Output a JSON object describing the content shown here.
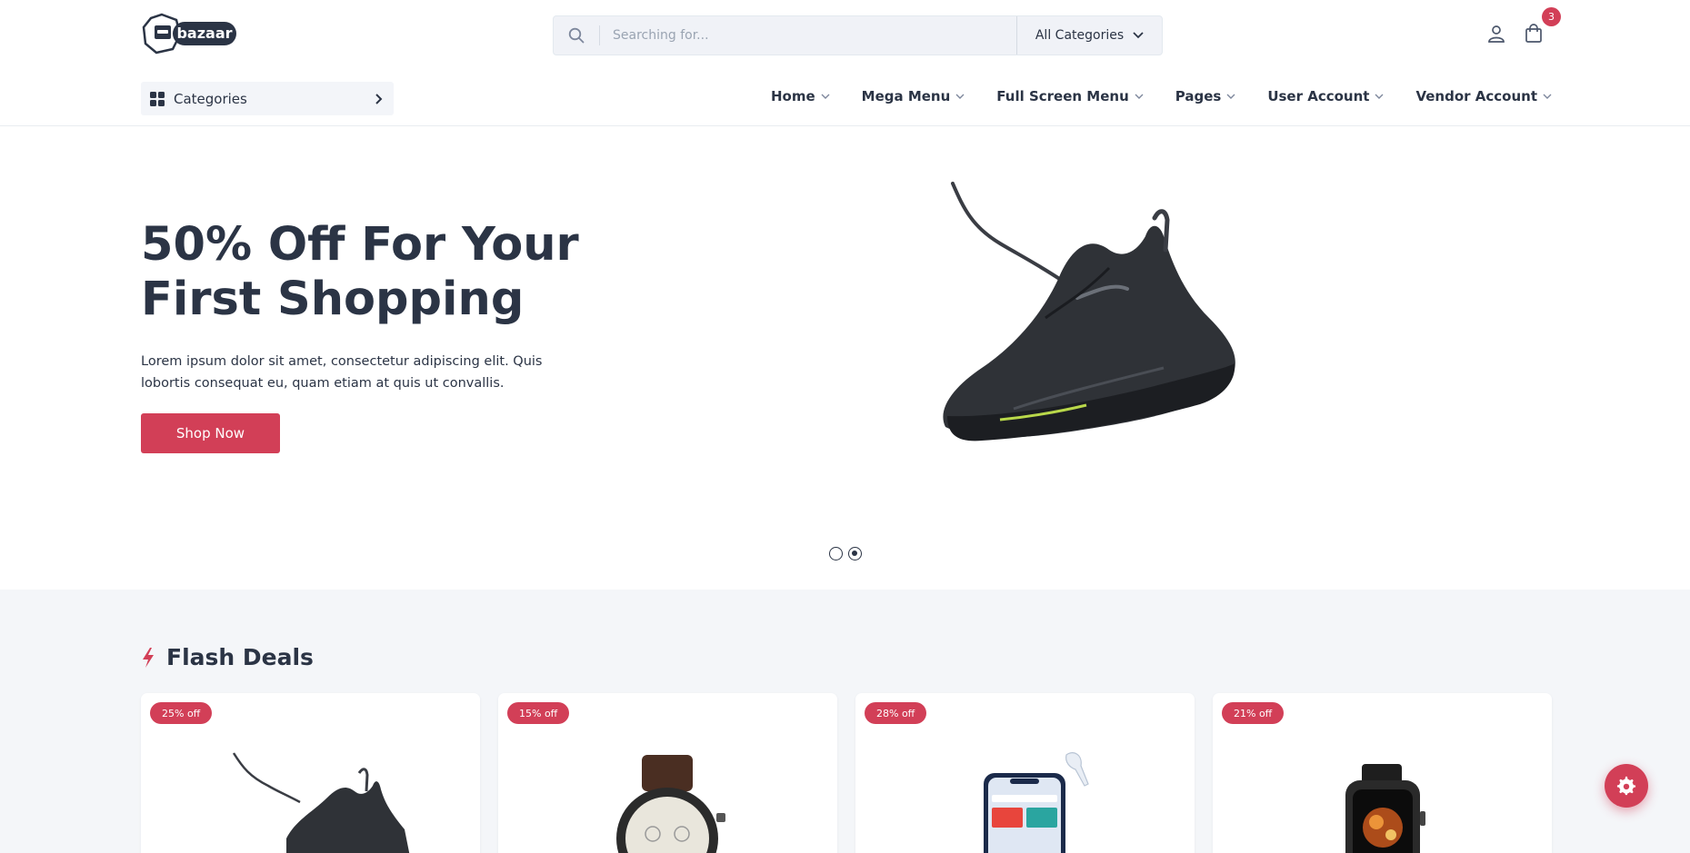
{
  "brand": {
    "logo_text": "bazaar"
  },
  "search": {
    "placeholder": "Searching for...",
    "category_label": "All Categories"
  },
  "header": {
    "cart_count": "3"
  },
  "nav": {
    "categories_label": "Categories",
    "items": [
      {
        "label": "Home"
      },
      {
        "label": "Mega Menu"
      },
      {
        "label": "Full Screen Menu"
      },
      {
        "label": "Pages"
      },
      {
        "label": "User Account"
      },
      {
        "label": "Vendor Account"
      }
    ]
  },
  "hero": {
    "title_line1": "50% Off For Your",
    "title_line2": "First Shopping",
    "description": "Lorem ipsum dolor sit amet, consectetur adipiscing elit. Quis lobortis consequat eu, quam etiam at quis ut convallis.",
    "button_label": "Shop Now",
    "slides_total": 2,
    "active_slide": 2
  },
  "flash_deals": {
    "title": "Flash Deals",
    "products": [
      {
        "discount": "25% off",
        "image": "sneaker"
      },
      {
        "discount": "15% off",
        "image": "wristwatch"
      },
      {
        "discount": "28% off",
        "image": "smartphone-with-earbud"
      },
      {
        "discount": "21% off",
        "image": "smartwatch"
      }
    ]
  },
  "colors": {
    "accent": "#d23f57",
    "text": "#2b3445",
    "section_bg": "#f4f6f9"
  }
}
